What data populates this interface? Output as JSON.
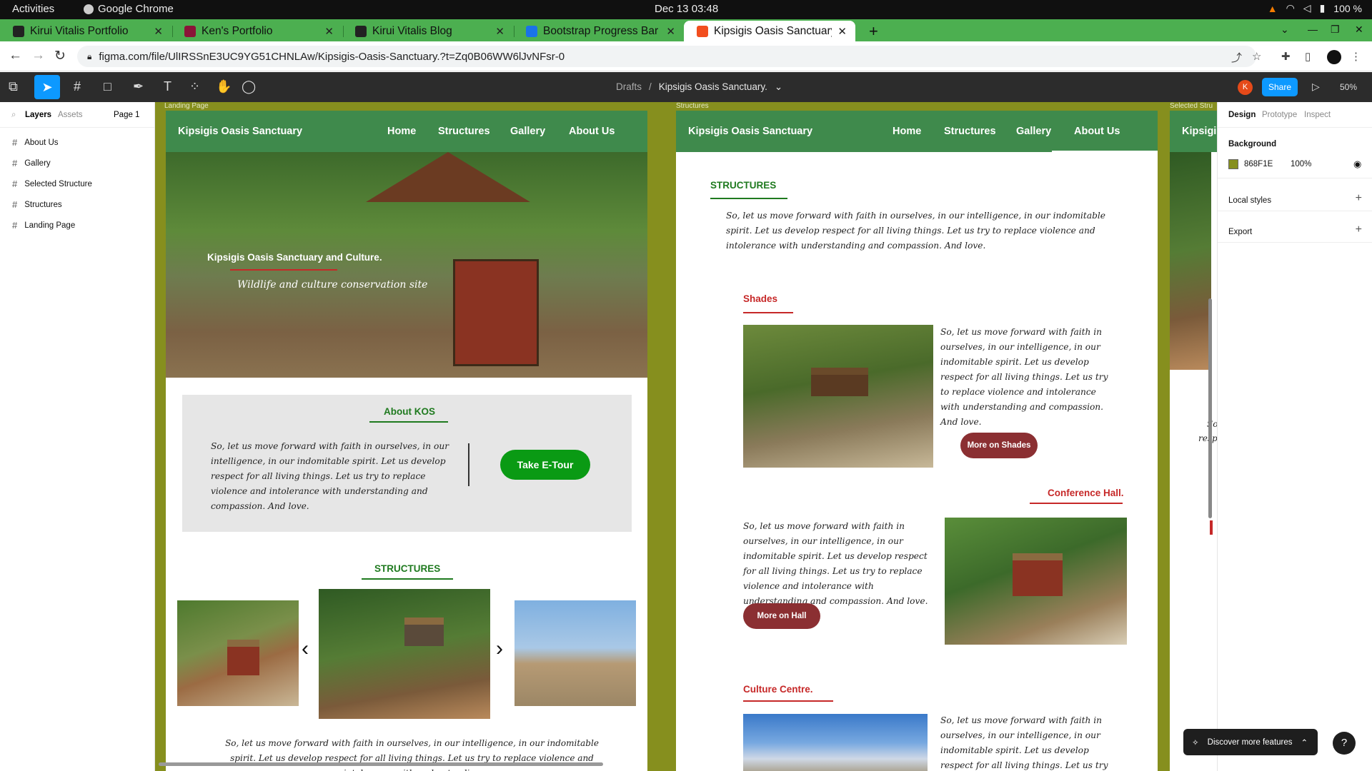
{
  "system_bar": {
    "activities": "Activities",
    "app_name": "Google Chrome",
    "clock": "Dec 13  03:48",
    "battery": "100 %"
  },
  "browser": {
    "tabs": [
      {
        "title": "Kirui Vitalis Portfolio",
        "favicon_color": "#222222",
        "active": false
      },
      {
        "title": "Ken's Portfolio",
        "favicon_color": "#8a1538",
        "active": false
      },
      {
        "title": "Kirui Vitalis Blog",
        "favicon_color": "#222222",
        "active": false
      },
      {
        "title": "Bootstrap Progress Bar -",
        "favicon_color": "#1a73e8",
        "active": false
      },
      {
        "title": "Kipsigis Oasis Sanctuary.",
        "favicon_color": "#f24e1e",
        "active": true
      }
    ],
    "url": "figma.com/file/UlIRSSnE3UC9YG51CHNLAw/Kipsigis-Oasis-Sanctuary.?t=Zq0B06WW6lJvNFsr-0"
  },
  "figma": {
    "toolbar": {
      "breadcrumb_parent": "Drafts",
      "breadcrumb_sep": "/",
      "file_name": "Kipsigis Oasis Sanctuary.",
      "avatar_initial": "K",
      "share_label": "Share",
      "zoom": "50%"
    },
    "left_panel": {
      "tab_layers": "Layers",
      "tab_assets": "Assets",
      "page": "Page 1",
      "layers": [
        "About Us",
        "Gallery",
        "Selected Structure",
        "Structures",
        "Landing Page"
      ]
    },
    "right_panel": {
      "tab_design": "Design",
      "tab_prototype": "Prototype",
      "tab_inspect": "Inspect",
      "background_label": "Background",
      "background_hex": "868F1E",
      "background_opacity": "100%",
      "local_styles": "Local styles",
      "export": "Export"
    },
    "canvas": {
      "background_color": "#868f1e",
      "frame_labels": {
        "landing": "Landing Page",
        "structures": "Structures",
        "selected": "Selected Stru"
      },
      "nav": {
        "brand": "Kipsigis Oasis Sanctuary",
        "brand_cut": "Kipsigis",
        "home": "Home",
        "structures": "Structures",
        "gallery": "Gallery",
        "about": "About Us"
      },
      "landing": {
        "hero_title": "Kipsigis Oasis Sanctuary and Culture.",
        "hero_subtitle": "Wildlife and culture  conservation site",
        "about_title": "About KOS",
        "about_text": "So, let us move forward with faith in ourselves, in our intelligence, in our indomitable spirit. Let us develop respect for all living things. Let us try to replace violence and intolerance with understanding and compassion. And love.",
        "tour_button": "Take E-Tour",
        "structures_title": "STRUCTURES",
        "bottom_text": "So, let us move forward with faith in ourselves, in our intelligence, in our indomitable spirit. Let us develop respect for all living things. Let us try to replace violence and intolerance with understanding"
      },
      "structures_page": {
        "title": "STRUCTURES",
        "intro": "So, let us move forward with faith in ourselves, in our intelligence, in our indomitable spirit. Let us develop respect for all living things. Let us try to replace violence and intolerance with understanding and compassion. And love.",
        "shades_title": "Shades",
        "shades_text": "So, let us move forward with faith in ourselves, in our intelligence, in our indomitable spirit. Let us develop respect for all living things. Let us try to replace violence and intolerance with understanding and compassion. And love.",
        "shades_button": "More on Shades",
        "hall_title": "Conference Hall.",
        "hall_text": "So, let us move forward with faith in ourselves, in our intelligence, in our indomitable spirit. Let us develop respect for all living things. Let us try to replace violence and intolerance with understanding and compassion. And love.",
        "hall_button": "More on Hall",
        "culture_title": "Culture Centre.",
        "culture_text": "So, let us move forward with faith in ourselves, in our intelligence, in our indomitable spirit. Let us develop respect for all living things. Let us try to replace violence"
      },
      "selected_fragments": {
        "text1": "So,",
        "text2": "respe"
      }
    },
    "discover_label": "Discover more features",
    "help_label": "?"
  }
}
